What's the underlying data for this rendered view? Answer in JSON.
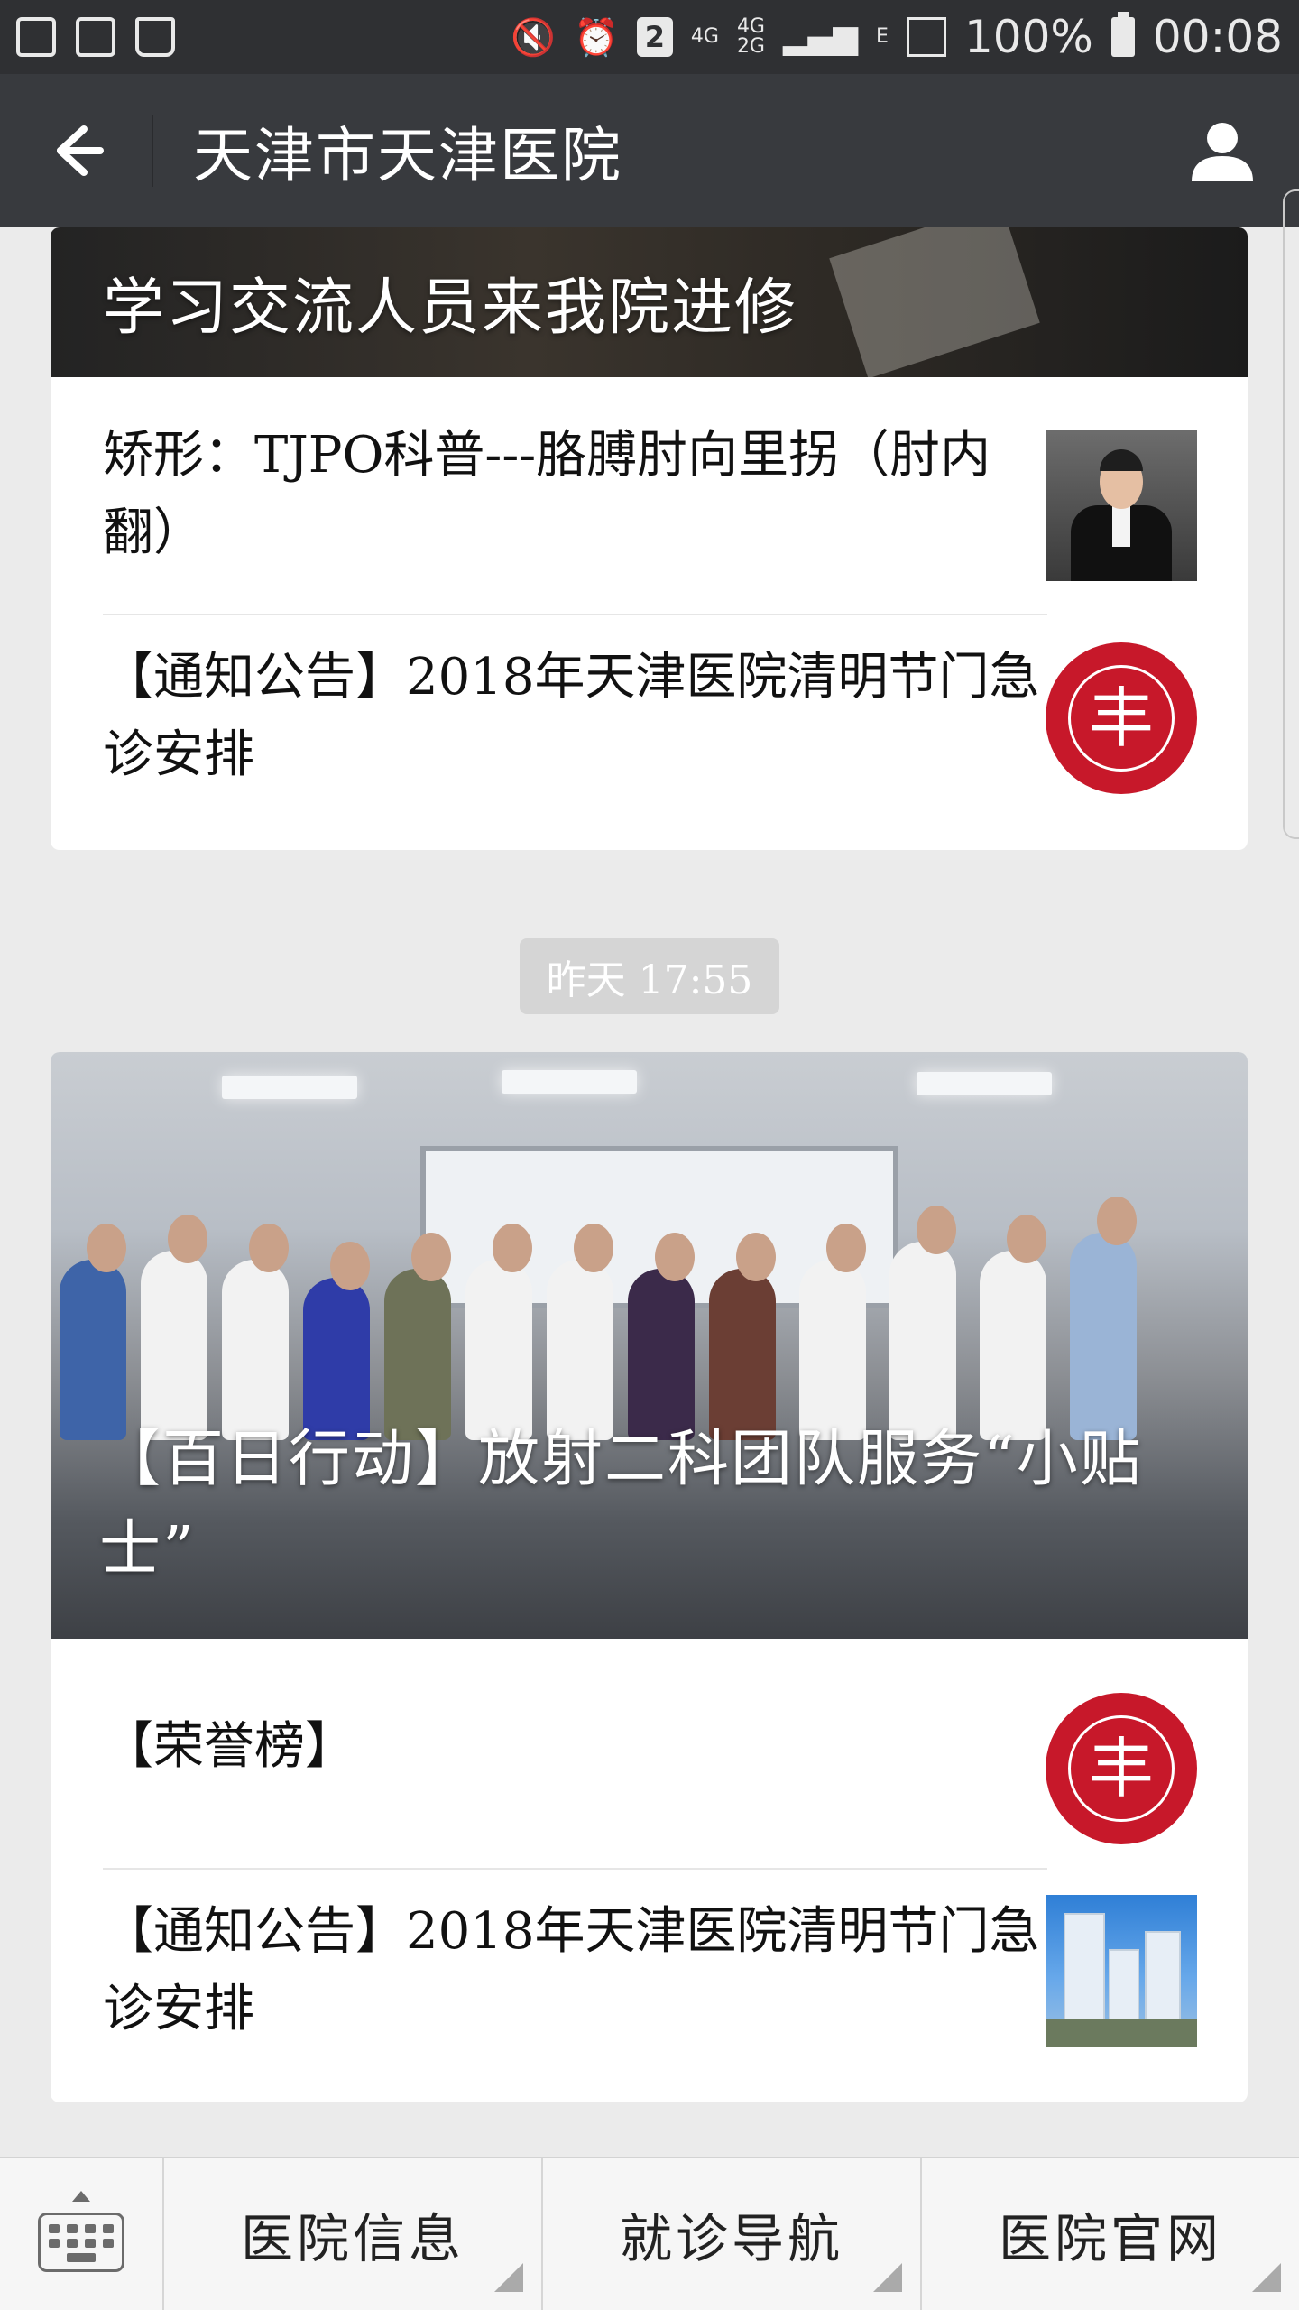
{
  "status_bar": {
    "battery": "100%",
    "time": "00:08",
    "notification_count": "2",
    "network_labels": [
      "4G",
      "4G",
      "2G",
      "E"
    ]
  },
  "navbar": {
    "title": "天津市天津医院"
  },
  "feed": {
    "group1": {
      "hero_title": "学习交流人员来我院进修",
      "articles": [
        {
          "title": "矫形：TJPO科普---胳膊肘向里拐（肘内翻）",
          "thumbnail": "doctor-portrait"
        },
        {
          "title": "【通知公告】2018年天津医院清明节门急诊安排",
          "thumbnail": "hospital-logo"
        }
      ]
    },
    "timestamp": "昨天 17:55",
    "group2": {
      "hero_title": "【百日行动】放射二科团队服务“小贴士”",
      "articles": [
        {
          "title": "【荣誉榜】",
          "thumbnail": "hospital-logo"
        },
        {
          "title": "【通知公告】2018年天津医院清明节门急诊安排",
          "thumbnail": "hospital-building"
        }
      ]
    }
  },
  "logo_glyph": "丰",
  "bottom_menu": {
    "items": [
      "医院信息",
      "就诊导航",
      "医院官网"
    ]
  },
  "colors": {
    "status_bar": "#2f3033",
    "navbar": "#383a3e",
    "background": "#ebebeb",
    "logo_red": "#c7182a"
  }
}
